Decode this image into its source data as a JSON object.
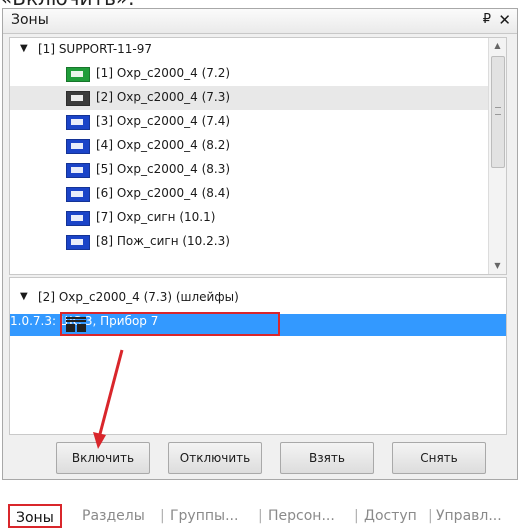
{
  "header_cut_text": "«Включить».",
  "panel": {
    "title": "Зоны",
    "pin_glyph": "₽",
    "close_glyph": "✕"
  },
  "tree_top": {
    "root_label": "[1] SUPPORT-11-97",
    "zones": [
      {
        "label": "[1] Охр_с2000_4 (7.2)",
        "color": "#1f9d3a",
        "selected": false
      },
      {
        "label": "[2] Охр_с2000_4 (7.3)",
        "color": "#3c3c3c",
        "selected": true
      },
      {
        "label": "[3] Охр_с2000_4 (7.4)",
        "color": "#1b44c8",
        "selected": false
      },
      {
        "label": "[4] Охр_с2000_4 (8.2)",
        "color": "#1b44c8",
        "selected": false
      },
      {
        "label": "[5] Охр_с2000_4 (8.3)",
        "color": "#1b44c8",
        "selected": false
      },
      {
        "label": "[6] Охр_с2000_4 (8.4)",
        "color": "#1b44c8",
        "selected": false
      },
      {
        "label": "[7] Охр_сигн (10.1)",
        "color": "#1b44c8",
        "selected": false
      },
      {
        "label": "[8] Пож_сигн (10.2.3)",
        "color": "#1b44c8",
        "selected": false
      }
    ]
  },
  "tree_bottom": {
    "root_label": "[2] Охр_с2000_4 (7.3) (шлейфы)",
    "loop_label": "1.0.7.3: ШС 3, Прибор 7"
  },
  "buttons": {
    "enable": "Включить",
    "disable": "Отключить",
    "arm": "Взять",
    "disarm": "Снять"
  },
  "tabs": [
    "Зоны",
    "Разделы",
    "Группы...",
    "Персон...",
    "Доступ",
    "Управл..."
  ],
  "colors": {
    "selection": "#3399ff",
    "highlight_red": "#d9262b"
  }
}
